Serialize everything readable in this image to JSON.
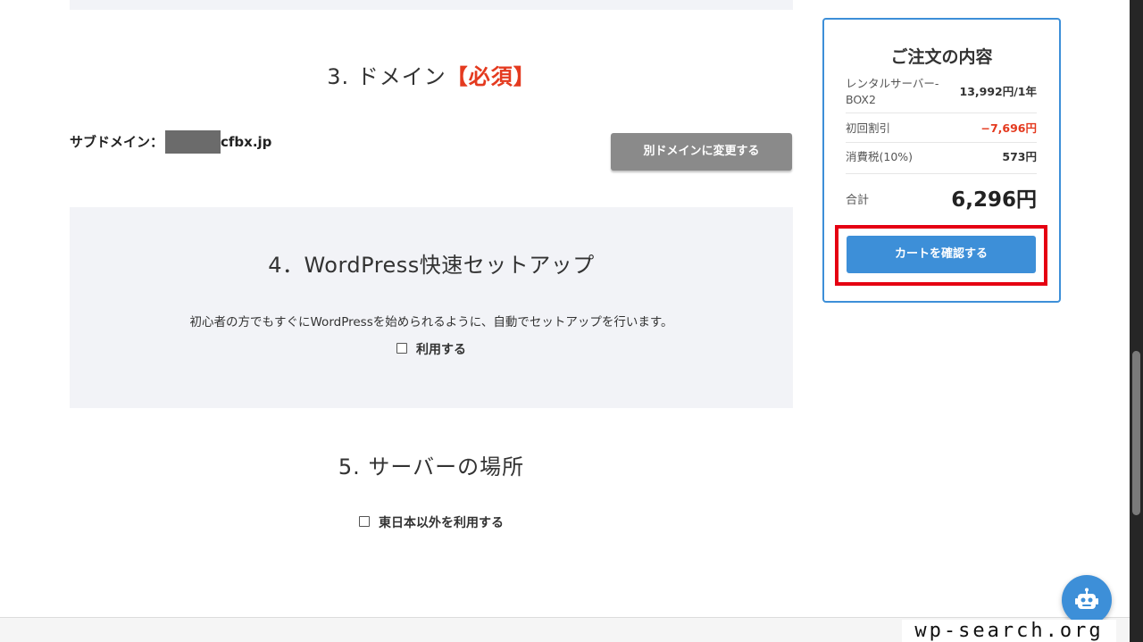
{
  "section3": {
    "title_prefix": "3. ドメイン",
    "title_required": "【必須】",
    "subdomain_label": "サブドメイン：",
    "subdomain_suffix": "cfbx.jp",
    "change_button": "別ドメインに変更する"
  },
  "section4": {
    "title": "4．WordPress快速セットアップ",
    "description": "初心者の方でもすぐにWordPressを始められるように、自動でセットアップを行います。",
    "checkbox_label": "利用する",
    "checked": false
  },
  "section5": {
    "title": "5. サーバーの場所",
    "checkbox_label": "東日本以外を利用する",
    "checked": false
  },
  "order": {
    "title": "ご注文の内容",
    "item_label": "レンタルサーバー-BOX2",
    "item_value": "13,992円/1年",
    "discount_label": "初回割引",
    "discount_value": "−7,696円",
    "tax_label": "消費税(10%)",
    "tax_value": "573円",
    "total_label": "合計",
    "total_value": "6,296円",
    "cart_button": "カートを確認する"
  },
  "watermark": "wp-search.org",
  "icons": {
    "chat": "robot-icon",
    "checkbox": "checkbox-icon"
  },
  "colors": {
    "accent": "#3d8fd8",
    "required": "#e43a1f",
    "highlight": "#e50012",
    "secondary_button": "#8a8a8a",
    "section_bg": "#f2f3f7"
  }
}
